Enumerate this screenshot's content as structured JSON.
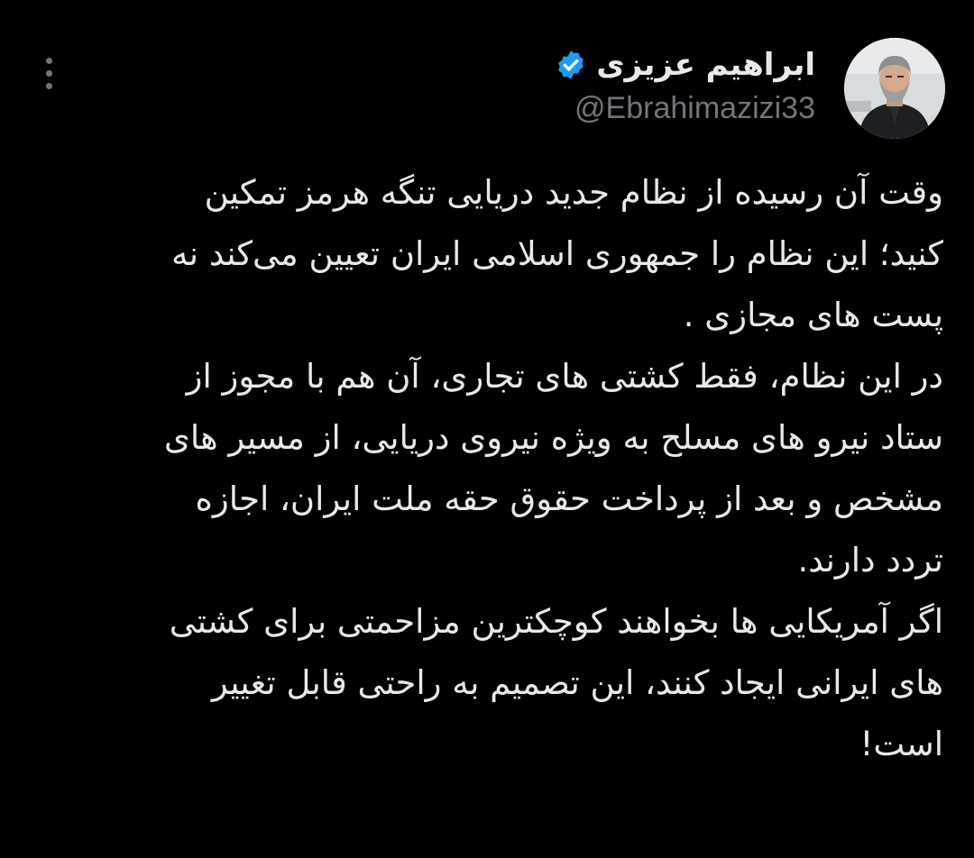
{
  "author": {
    "display_name": "ابراهیم عزیزی",
    "handle": "@Ebrahimazizi33",
    "verified_icon": "verified-badge-icon",
    "avatar_icon": "profile-photo"
  },
  "more_icon": "more-options-icon",
  "colors": {
    "background": "#000000",
    "text": "#e7e9ea",
    "secondary": "#71767b",
    "verified": "#1d9bf0"
  },
  "tweet": {
    "lines": [
      "وقت آن رسیده از نظام جدید دریایی تنگه هرمز تمکین",
      "کنید؛ این نظام را جمهوری اسلامی ایران تعیین می‌کند نه",
      "پست های مجازی .",
      "در این نظام، فقط کشتی های تجاری، آن هم با مجوز از",
      "ستاد نیرو های مسلح به ویژه نیروی دریایی، از مسیر های",
      "مشخص و بعد از پرداخت حقوق حقه ملت ایران، اجازه",
      "تردد دارند.",
      "اگر آمریکایی ها بخواهند کوچکترین مزاحمتی برای کشتی",
      "های ایرانی ایجاد کنند، این تصمیم به راحتی قابل تغییر",
      "است!"
    ]
  }
}
